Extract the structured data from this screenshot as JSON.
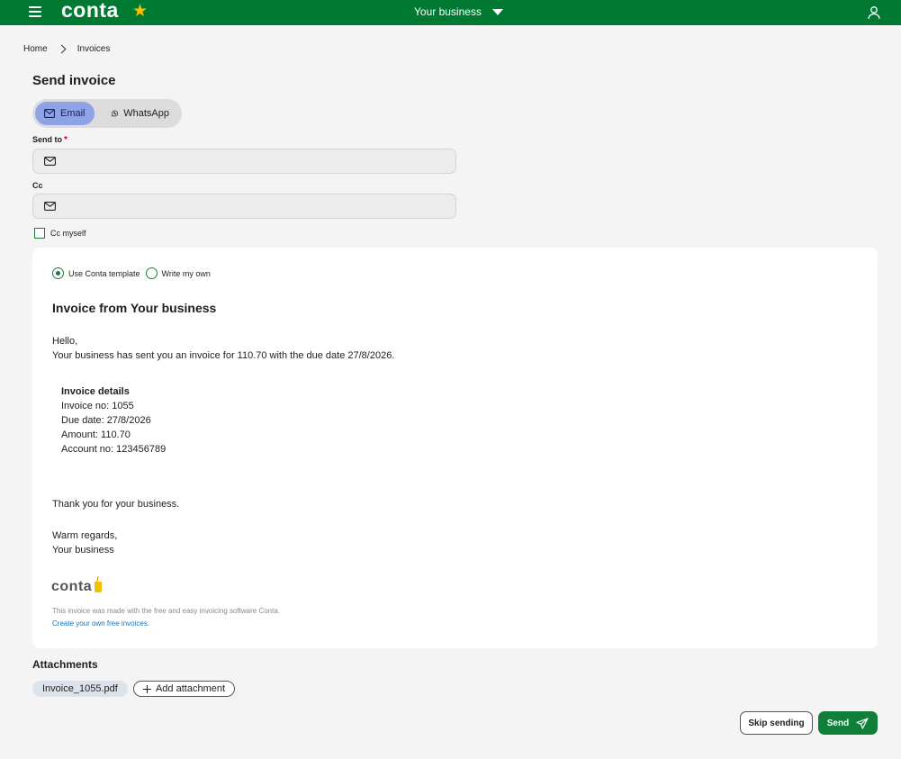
{
  "header": {
    "logo": "conta",
    "business_name": "Your business"
  },
  "breadcrumb": {
    "home": "Home",
    "current": "Invoices"
  },
  "page": {
    "title": "Send invoice"
  },
  "channel": {
    "email_label": "Email",
    "whatsapp_label": "WhatsApp",
    "selected": "Email"
  },
  "form": {
    "send_to_label": "Send to",
    "send_to_required": "*",
    "send_to_value": "",
    "cc_label": "Cc",
    "cc_value": "",
    "cc_myself_label": "Cc myself",
    "cc_myself_checked": false
  },
  "message": {
    "template_option": "Use Conta template",
    "own_option": "Write my own",
    "selected_option": "Use Conta template",
    "title": "Invoice from Your business",
    "greeting": "Hello,",
    "intro": "Your business has sent you an invoice for 110.70 with the due date 27/8/2026.",
    "details_heading": "Invoice details",
    "invoice_no": "Invoice no: 1055",
    "due_date": "Due date: 27/8/2026",
    "amount": "Amount: 110.70",
    "account_no": "Account no: 123456789",
    "thanks": "Thank you for your business.",
    "regards": "Warm regards,",
    "signature": "Your business",
    "brand_logo": "conta",
    "footer_note": "This invoice was made with the free and easy invoicing software Conta.",
    "footer_link": "Create your own free invoices."
  },
  "attachments": {
    "title": "Attachments",
    "file": "Invoice_1055.pdf",
    "add_label": "Add attachment"
  },
  "actions": {
    "skip_label": "Skip sending",
    "send_label": "Send"
  },
  "colors": {
    "brand_green": "#007a33",
    "star": "#f5c000",
    "email_selected": "#8ea2e6",
    "link_blue": "#1673b9"
  },
  "icons": [
    "menu-icon",
    "star-icon",
    "chevron-down-icon",
    "user-icon",
    "mail-icon",
    "whatsapp-icon",
    "chevron-right-icon",
    "plus-icon",
    "send-icon"
  ]
}
